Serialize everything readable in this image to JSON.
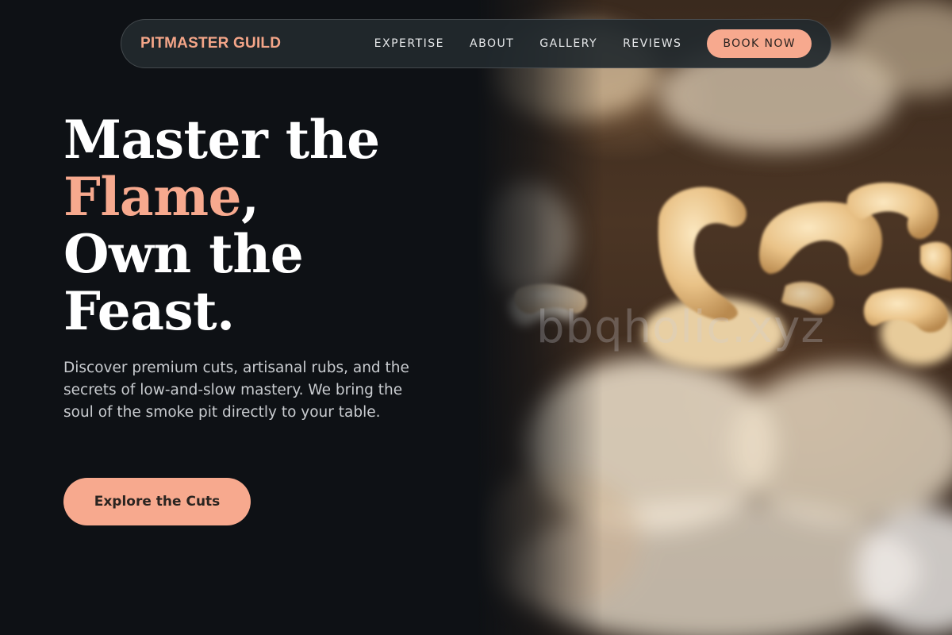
{
  "brand": {
    "name": "PITMASTER GUILD"
  },
  "nav": {
    "links": [
      "EXPERTISE",
      "ABOUT",
      "GALLERY",
      "REVIEWS"
    ],
    "cta_label": "BOOK NOW"
  },
  "hero": {
    "line1": "Master the",
    "accent": "Flame",
    "accent_suffix": ",",
    "line3": "Own the",
    "line4": "Feast.",
    "description": "Discover premium cuts, artisanal rubs, and the secrets of low-and-slow mastery. We bring the soul of the smoke pit directly to your table.",
    "cta_label": "Explore the Cuts"
  },
  "image": {
    "watermark": "bbqholic.xyz",
    "icon": "cashew-nuts-photo"
  },
  "colors": {
    "background": "#0e1115",
    "accent": "#f7a98e",
    "navbar": "#22292e",
    "text": "#ffffff",
    "muted_text": "#c9ccd0"
  }
}
